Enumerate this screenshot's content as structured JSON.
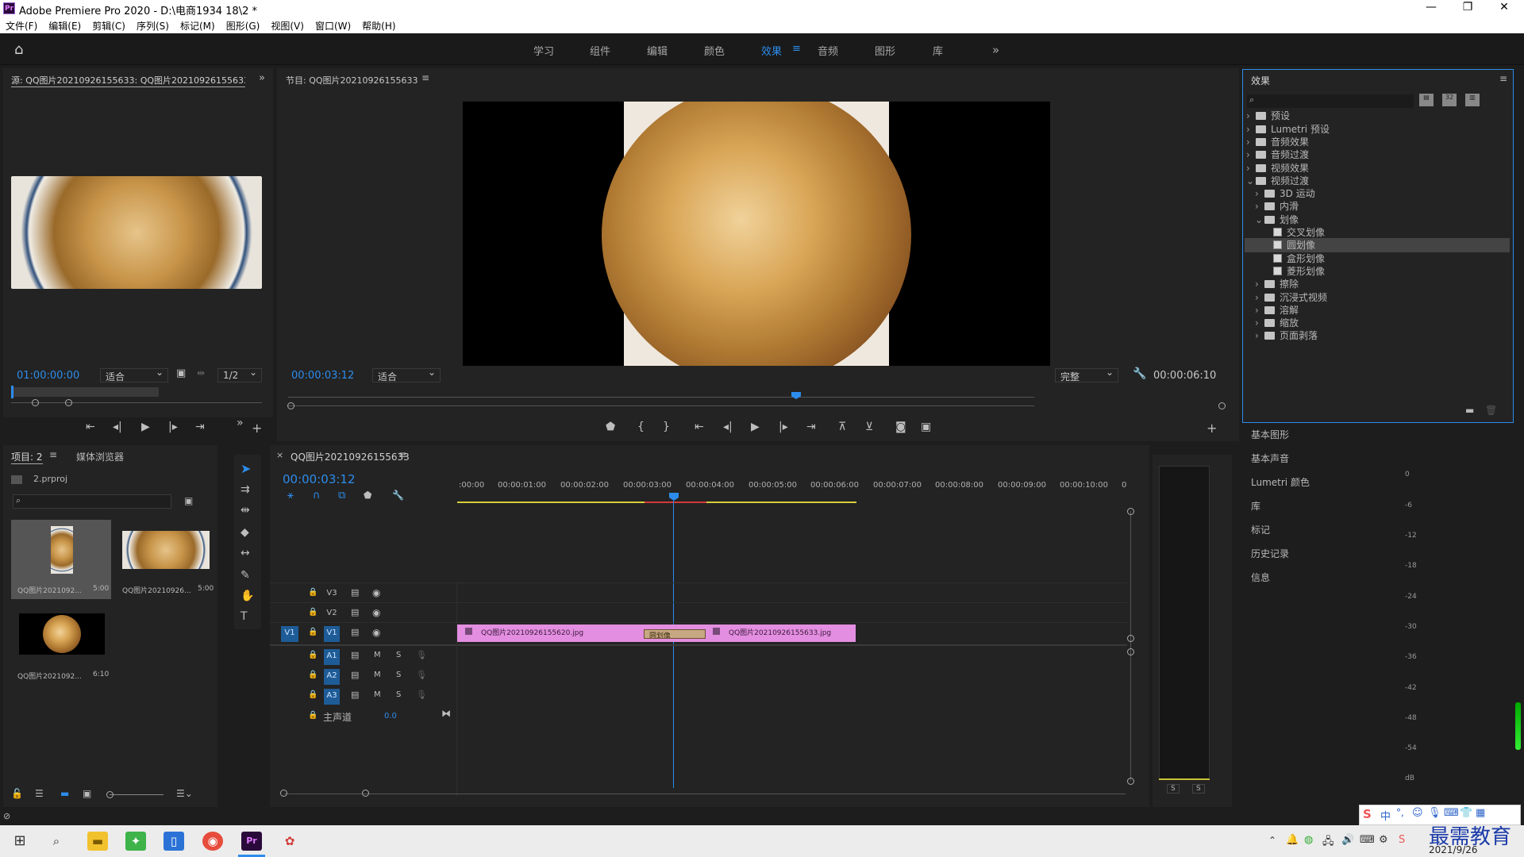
{
  "app": {
    "title": "Adobe Premiere Pro 2020 - D:\\电商1934 18\\2 *",
    "logo": "Pr"
  },
  "menu": [
    "文件(F)",
    "编辑(E)",
    "剪辑(C)",
    "序列(S)",
    "标记(M)",
    "图形(G)",
    "视图(V)",
    "窗口(W)",
    "帮助(H)"
  ],
  "workspaces": {
    "tabs": [
      "学习",
      "组件",
      "编辑",
      "颜色",
      "效果",
      "音频",
      "图形",
      "库"
    ],
    "active": "效果"
  },
  "source_monitor": {
    "title": "源: QQ图片20210926155633: QQ图片20210926155633.",
    "timecode": "01:00:00:00",
    "fit": "适合",
    "resolution": "1/2"
  },
  "program_monitor": {
    "title": "节目: QQ图片20210926155633",
    "timecode": "00:00:03:12",
    "fit": "适合",
    "quality": "完整",
    "duration": "00:00:06:10"
  },
  "effects_panel": {
    "title": "效果",
    "tree": [
      {
        "label": "预设",
        "level": 0,
        "type": "folder",
        "open": false
      },
      {
        "label": "Lumetri 预设",
        "level": 0,
        "type": "folder",
        "open": false
      },
      {
        "label": "音频效果",
        "level": 0,
        "type": "folder",
        "open": false
      },
      {
        "label": "音频过渡",
        "level": 0,
        "type": "folder",
        "open": false
      },
      {
        "label": "视频效果",
        "level": 0,
        "type": "folder",
        "open": false
      },
      {
        "label": "视频过渡",
        "level": 0,
        "type": "folder",
        "open": true
      },
      {
        "label": "3D 运动",
        "level": 1,
        "type": "folder",
        "open": false
      },
      {
        "label": "内滑",
        "level": 1,
        "type": "folder",
        "open": false
      },
      {
        "label": "划像",
        "level": 1,
        "type": "folder",
        "open": true
      },
      {
        "label": "交叉划像",
        "level": 2,
        "type": "effect"
      },
      {
        "label": "圆划像",
        "level": 2,
        "type": "effect",
        "selected": true
      },
      {
        "label": "盒形划像",
        "level": 2,
        "type": "effect"
      },
      {
        "label": "菱形划像",
        "level": 2,
        "type": "effect"
      },
      {
        "label": "擦除",
        "level": 1,
        "type": "folder",
        "open": false
      },
      {
        "label": "沉浸式视频",
        "level": 1,
        "type": "folder",
        "open": false
      },
      {
        "label": "溶解",
        "level": 1,
        "type": "folder",
        "open": false
      },
      {
        "label": "缩放",
        "level": 1,
        "type": "folder",
        "open": false
      },
      {
        "label": "页面剥落",
        "level": 1,
        "type": "folder",
        "open": false
      }
    ]
  },
  "side_panels": [
    "基本图形",
    "基本声音",
    "Lumetri 颜色",
    "库",
    "标记",
    "历史记录",
    "信息"
  ],
  "project_panel": {
    "tab": "项目: 2",
    "tab2": "媒体浏览器",
    "file": "2.prproj",
    "items": [
      {
        "name": "QQ图片2021092...",
        "duration": "5:00"
      },
      {
        "name": "QQ图片20210926...",
        "duration": "5:00"
      },
      {
        "name": "QQ图片2021092...",
        "duration": "6:10"
      }
    ]
  },
  "timeline": {
    "sequence": "QQ图片20210926155633",
    "timecode": "00:00:03:12",
    "ruler": [
      ":00:00",
      "00:00:01:00",
      "00:00:02:00",
      "00:00:03:00",
      "00:00:04:00",
      "00:00:05:00",
      "00:00:06:00",
      "00:00:07:00",
      "00:00:08:00",
      "00:00:09:00",
      "00:00:10:00",
      "0"
    ],
    "video_tracks": [
      "V3",
      "V2",
      "V1"
    ],
    "audio_tracks": [
      "A1",
      "A2",
      "A3"
    ],
    "source_patch": "V1",
    "master": {
      "label": "主声道",
      "value": "0.0"
    },
    "clip1": "QQ图片20210926155620.jpg",
    "clip2": "QQ图片20210926155633.jpg",
    "transition": "圆划像",
    "m": "M",
    "s": "S"
  },
  "audio_meter": {
    "ticks": [
      "0",
      "-6",
      "-12",
      "-18",
      "-24",
      "-30",
      "-36",
      "-42",
      "-48",
      "-54",
      "dB"
    ],
    "solo": [
      "S",
      "S"
    ]
  },
  "taskbar": {
    "date": "2021/9/26",
    "watermark": "最需教育",
    "ime": "中"
  },
  "colors": {
    "accent": "#2d8ceb",
    "clip": "#e38ee0",
    "transition": "#c8a882",
    "track_on": "#1e5c97"
  }
}
